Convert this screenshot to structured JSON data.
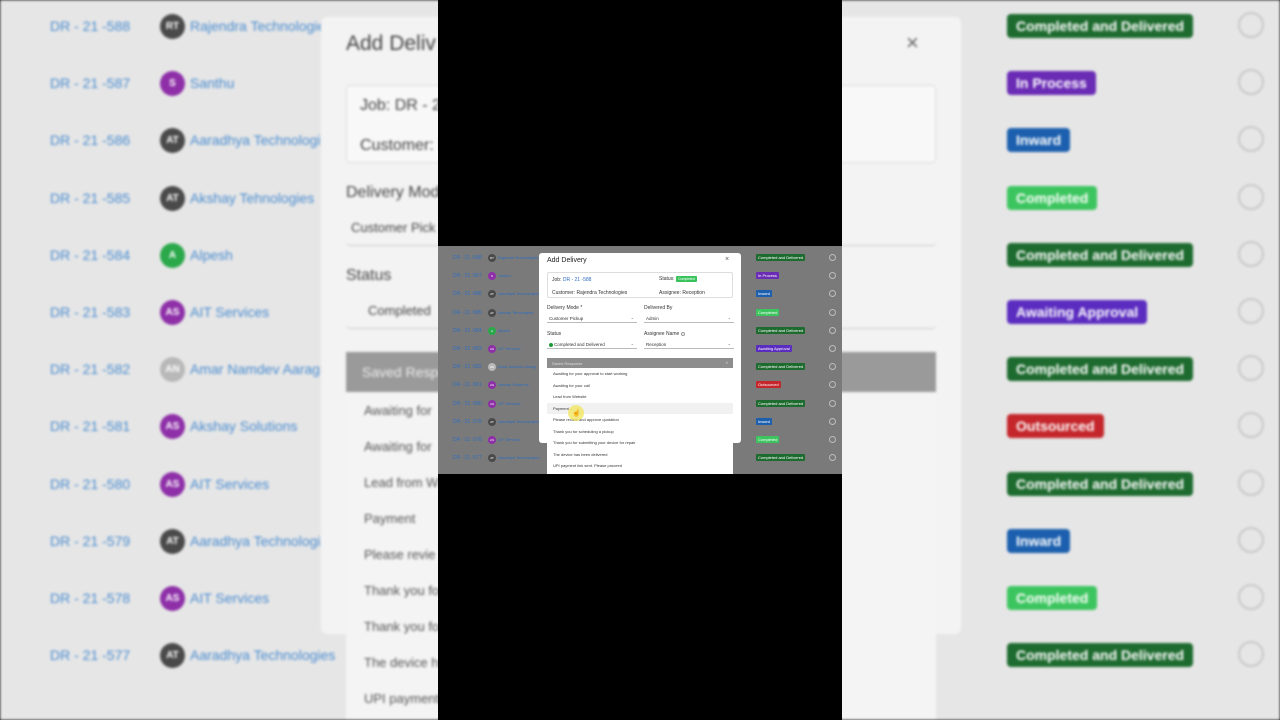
{
  "dialog": {
    "title": "Add Delivery",
    "close_glyph": "×",
    "job_label": "Job:",
    "job_value": "DR - 21 -588",
    "status_label": "Status:",
    "status_value": "Completed",
    "customer_label": "Customer: Rajendra Technologies",
    "assignee_label": "Assignee: Reception",
    "delivery_mode_label": "Delivery Mode *",
    "delivery_mode_value": "Customer Pickup",
    "delivered_by_label": "Delivered By",
    "delivered_by_value": "Admin",
    "status_field_label": "Status",
    "status_field_value": "Completed and Delivered",
    "assignee_name_label": "Assignee Name",
    "assignee_name_value": "Reception",
    "saved_response_placeholder": "Saved Response",
    "chevron": "⌄"
  },
  "saved_responses": [
    "Awaiting for your approval to start working",
    "Awaiting for your call",
    "Lead from Website",
    "Payment ...",
    "Please review and approve quotation",
    "Thank you for scheduling a pickup",
    "Thank you for submitting your device for repair",
    "The device has been delivered",
    "UPI payment link sent. Please proceed"
  ],
  "hover_index": 3,
  "cursor_icon": "☝",
  "colors": {
    "completed_delivered": "#1e6b2f",
    "in_process": "#6a2bb5",
    "inward": "#1b5fae",
    "completed": "#3cc55f",
    "awaiting_approval": "#5b2cc0",
    "outsourced": "#c4262b"
  },
  "jobs": [
    {
      "id": "DR - 21 -588",
      "initials": "RT",
      "avatar": "#4a4a4a",
      "name": "Rajendra Technologies",
      "status": "Completed and Delivered",
      "color": "#1e6b2f"
    },
    {
      "id": "DR - 21 -587",
      "initials": "S",
      "avatar": "#8e2fa8",
      "name": "Santhu",
      "status": "In Process",
      "color": "#6a2bb5"
    },
    {
      "id": "DR - 21 -586",
      "initials": "AT",
      "avatar": "#4a4a4a",
      "name": "Aaradhya Technologies",
      "status": "Inward",
      "color": "#1b5fae"
    },
    {
      "id": "DR - 21 -585",
      "initials": "AT",
      "avatar": "#4a4a4a",
      "name": "Akshay Tehnologies",
      "status": "Completed",
      "color": "#3cc55f"
    },
    {
      "id": "DR - 21 -584",
      "initials": "A",
      "avatar": "#2aa84a",
      "name": "Alpesh",
      "status": "Completed and Delivered",
      "color": "#1e6b2f"
    },
    {
      "id": "DR - 21 -583",
      "initials": "AS",
      "avatar": "#8e2fa8",
      "name": "AIT Services",
      "status": "Awaiting Approval",
      "color": "#5b2cc0"
    },
    {
      "id": "DR - 21 -582",
      "initials": "AN",
      "avatar": "#b8b8b8",
      "name": "Amar Namdev Aaragi",
      "status": "Completed and Delivered",
      "color": "#1e6b2f"
    },
    {
      "id": "DR - 21 -581",
      "initials": "AS",
      "avatar": "#8e2fa8",
      "name": "Akshay Solutions",
      "status": "Outsourced",
      "color": "#c4262b"
    },
    {
      "id": "DR - 21 -580",
      "initials": "AS",
      "avatar": "#8e2fa8",
      "name": "AIT Services",
      "status": "Completed and Delivered",
      "color": "#1e6b2f"
    },
    {
      "id": "DR - 21 -579",
      "initials": "AT",
      "avatar": "#4a4a4a",
      "name": "Aaradhya Technologies",
      "status": "Inward",
      "color": "#1b5fae"
    },
    {
      "id": "DR - 21 -578",
      "initials": "AS",
      "avatar": "#8e2fa8",
      "name": "AIT Services",
      "status": "Completed",
      "color": "#3cc55f"
    },
    {
      "id": "DR - 21 -577",
      "initials": "AT",
      "avatar": "#4a4a4a",
      "name": "Aaradhya Technologies",
      "status": "Completed and Delivered",
      "color": "#1e6b2f"
    }
  ],
  "background": {
    "title": "Add Deliv",
    "job": "Job: DR - 2",
    "customer": "Customer: I",
    "delivery_mode": "Delivery Mod",
    "delivery_mode_value": "Customer Pick",
    "status": "Status",
    "status_value": "Completed",
    "saved_response": "Saved Respo",
    "items": [
      "Awaiting for",
      "Awaiting for",
      "Lead from W",
      "Payment",
      "Please revie",
      "Thank you fo",
      "Thank you fo",
      "The device h",
      "UPI payment"
    ]
  }
}
